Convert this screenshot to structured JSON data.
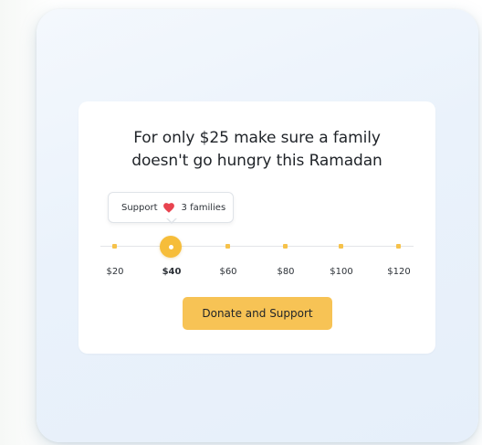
{
  "headline": {
    "line1": "For only $25 make sure a family",
    "line2": "doesn't go hungry this Ramadan"
  },
  "tooltip": {
    "prefix": "Support",
    "icon": "heart-icon",
    "suffix": "3 families"
  },
  "slider": {
    "selected_value": "$40",
    "options": [
      "$20",
      "$40",
      "$60",
      "$80",
      "$100",
      "$120"
    ]
  },
  "button": {
    "label": "Donate and Support"
  },
  "colors": {
    "accent": "#f6bd3a",
    "heart": "#e8434f",
    "text": "#1f2328"
  }
}
